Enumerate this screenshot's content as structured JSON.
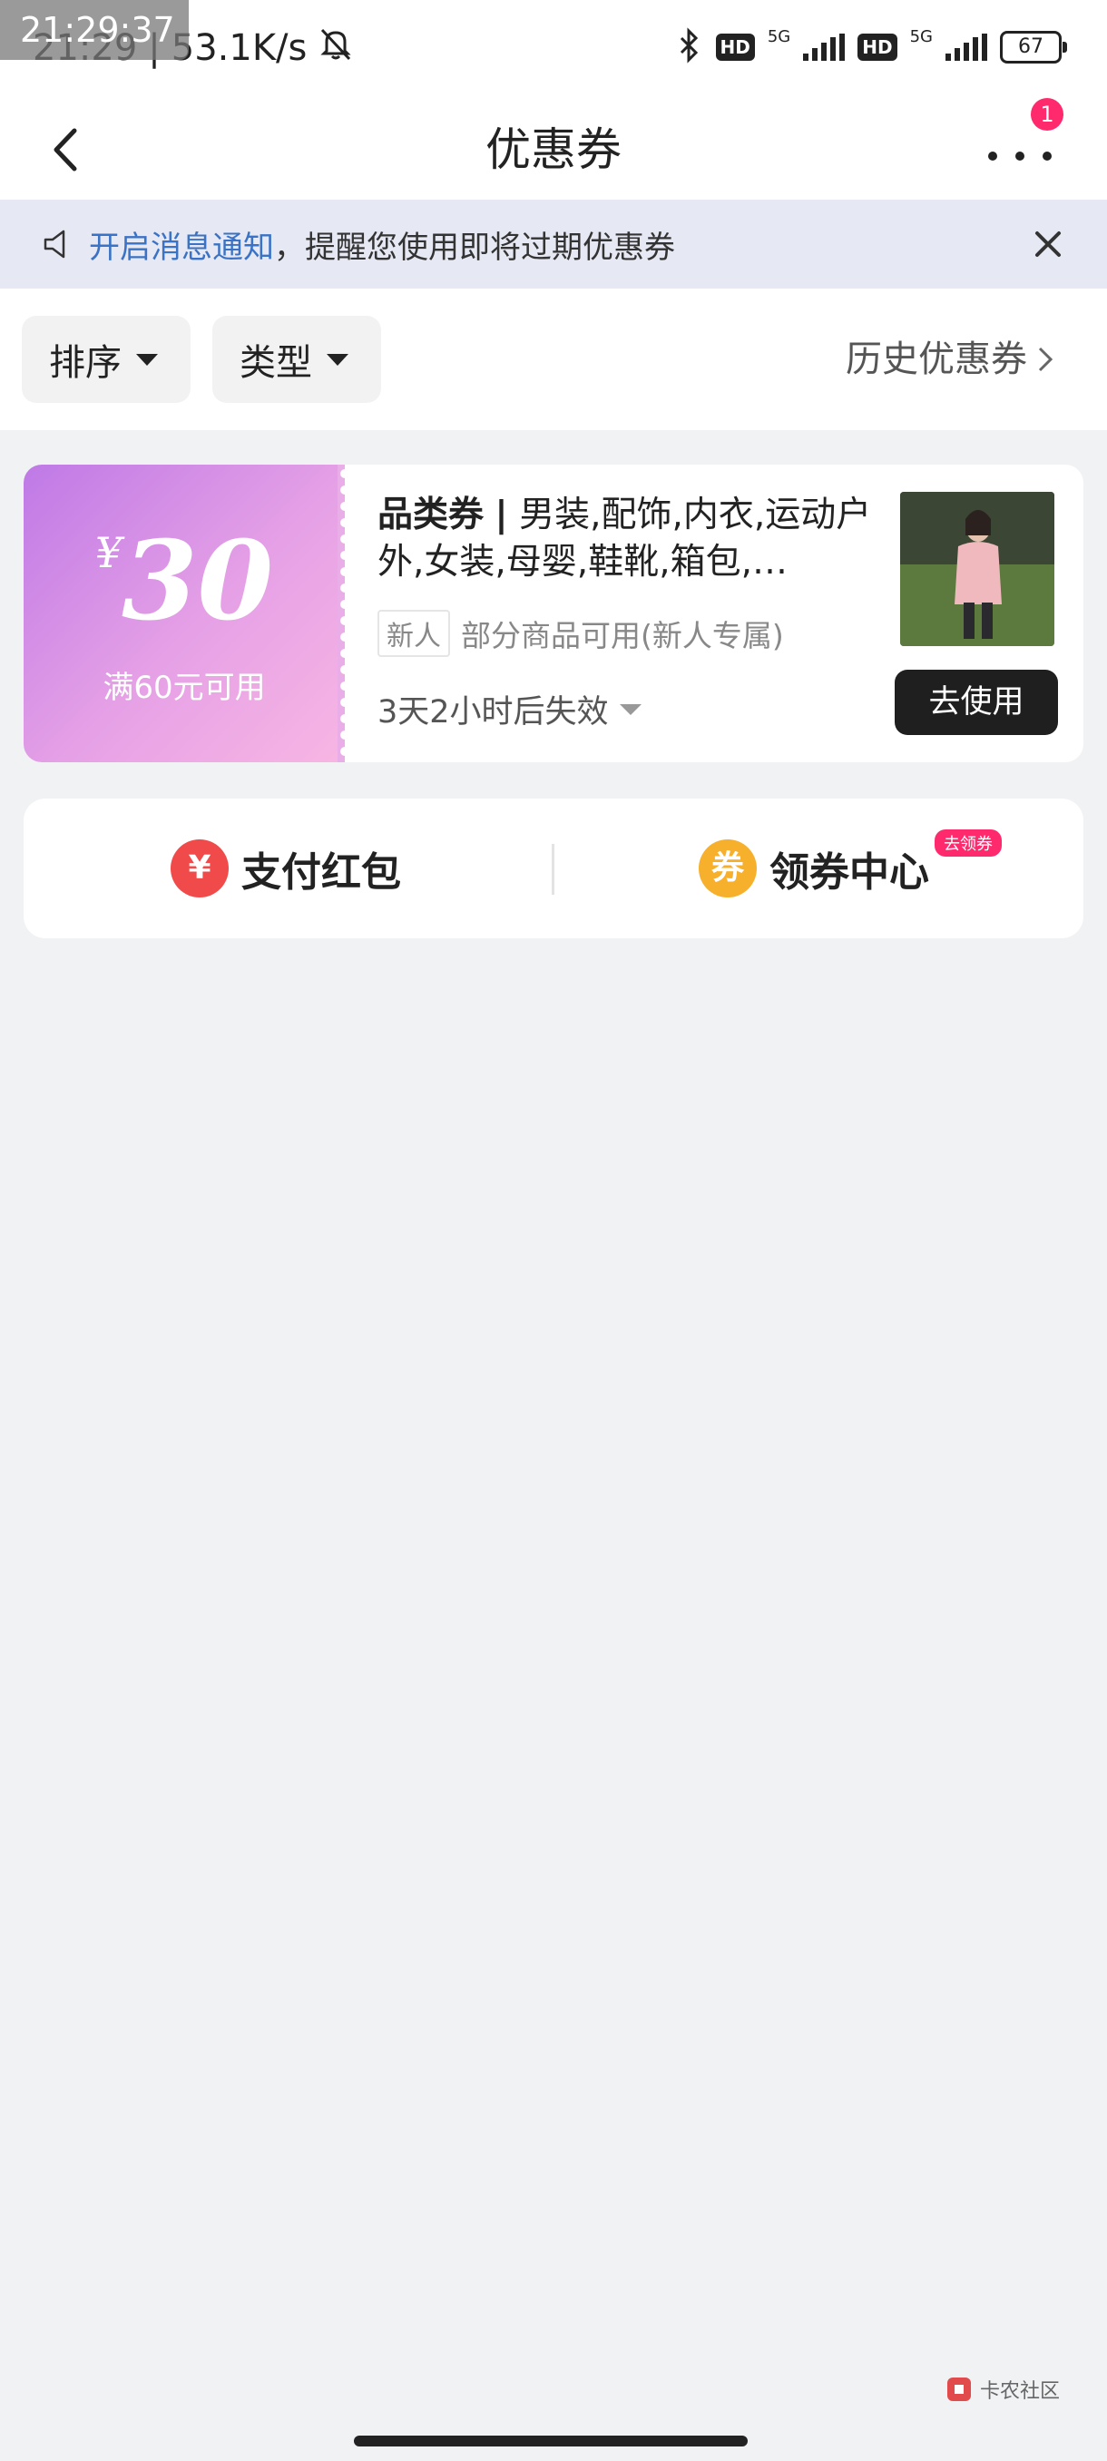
{
  "status_bar": {
    "time_overlay": "21:29:37",
    "time": "21:29",
    "net_speed": "53.1K/s",
    "hd1": "HD",
    "five_g1": "5G",
    "hd2": "HD",
    "five_g2": "5G",
    "battery": "67"
  },
  "nav": {
    "title": "优惠券",
    "more_badge": "1"
  },
  "notice": {
    "link_text": "开启消息通知",
    "text": "，提醒您使用即将过期优惠券"
  },
  "filters": {
    "sort_label": "排序",
    "type_label": "类型",
    "history_label": "历史优惠券"
  },
  "coupon": {
    "currency": "¥",
    "amount": "30",
    "min_spend": "满60元可用",
    "category_label": "品类券",
    "separator": "|",
    "description": "男装,配饰,内衣,运动户外,女装,母婴,鞋靴,箱包,…",
    "tag": "新人",
    "scope": "部分商品可用(新人专属)",
    "expiry": "3天2小时后失效",
    "use_button": "去使用"
  },
  "quick_links": {
    "pay_red_packet": {
      "icon_glyph": "¥",
      "label": "支付红包"
    },
    "coupon_center": {
      "icon_glyph": "券",
      "label": "领券中心",
      "badge": "去领券"
    }
  },
  "watermark": "卡农社区",
  "colors": {
    "accent_link": "#3a73c6",
    "badge_pink": "#ff2a6d",
    "coupon_gradient_start": "#bf79e6",
    "coupon_gradient_end": "#f7b6e3",
    "button_dark": "#1f1f1f",
    "pay_icon": "#f04a4a",
    "center_icon": "#f6b02b"
  }
}
